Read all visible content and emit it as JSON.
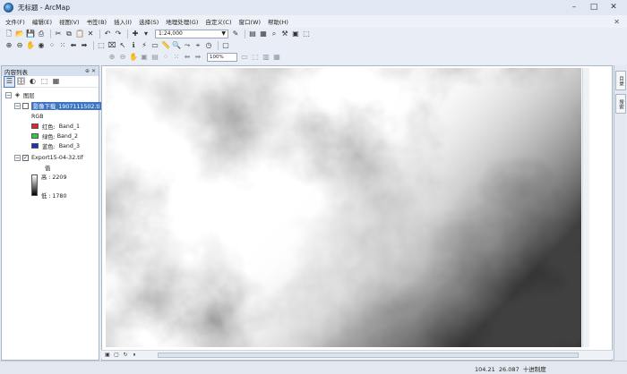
{
  "window": {
    "title": "无标题 - ArcMap",
    "icon": "arcmap-globe-icon"
  },
  "menu": [
    "文件(F)",
    "编辑(E)",
    "视图(V)",
    "书签(B)",
    "插入(I)",
    "选择(S)",
    "地理处理(G)",
    "自定义(C)",
    "窗口(W)",
    "帮助(H)"
  ],
  "toolbar": {
    "scale": "1:24,000",
    "zoom": "100%"
  },
  "toc": {
    "title": "内容列表",
    "root": "图层",
    "layer1": {
      "name": "影像下载_1907111502.ti",
      "renderer": "RGB",
      "bands": [
        {
          "label": "红色:",
          "value": "Band_1",
          "color": "#e8202a"
        },
        {
          "label": "绿色:",
          "value": "Band_2",
          "color": "#35c64a"
        },
        {
          "label": "蓝色:",
          "value": "Band_3",
          "color": "#1f2fbf"
        }
      ]
    },
    "layer2": {
      "name": "Export15-04-32.tif",
      "field": "值",
      "high": "高 : 2209",
      "low": "低 : 1780"
    }
  },
  "right_tabs": [
    "目录",
    "搜索"
  ],
  "status": {
    "x": "104.21",
    "y": "26.087",
    "units": "十进制度"
  },
  "colors": {
    "titlebar": "#dfe8f3",
    "selected": "#3d74c4"
  }
}
